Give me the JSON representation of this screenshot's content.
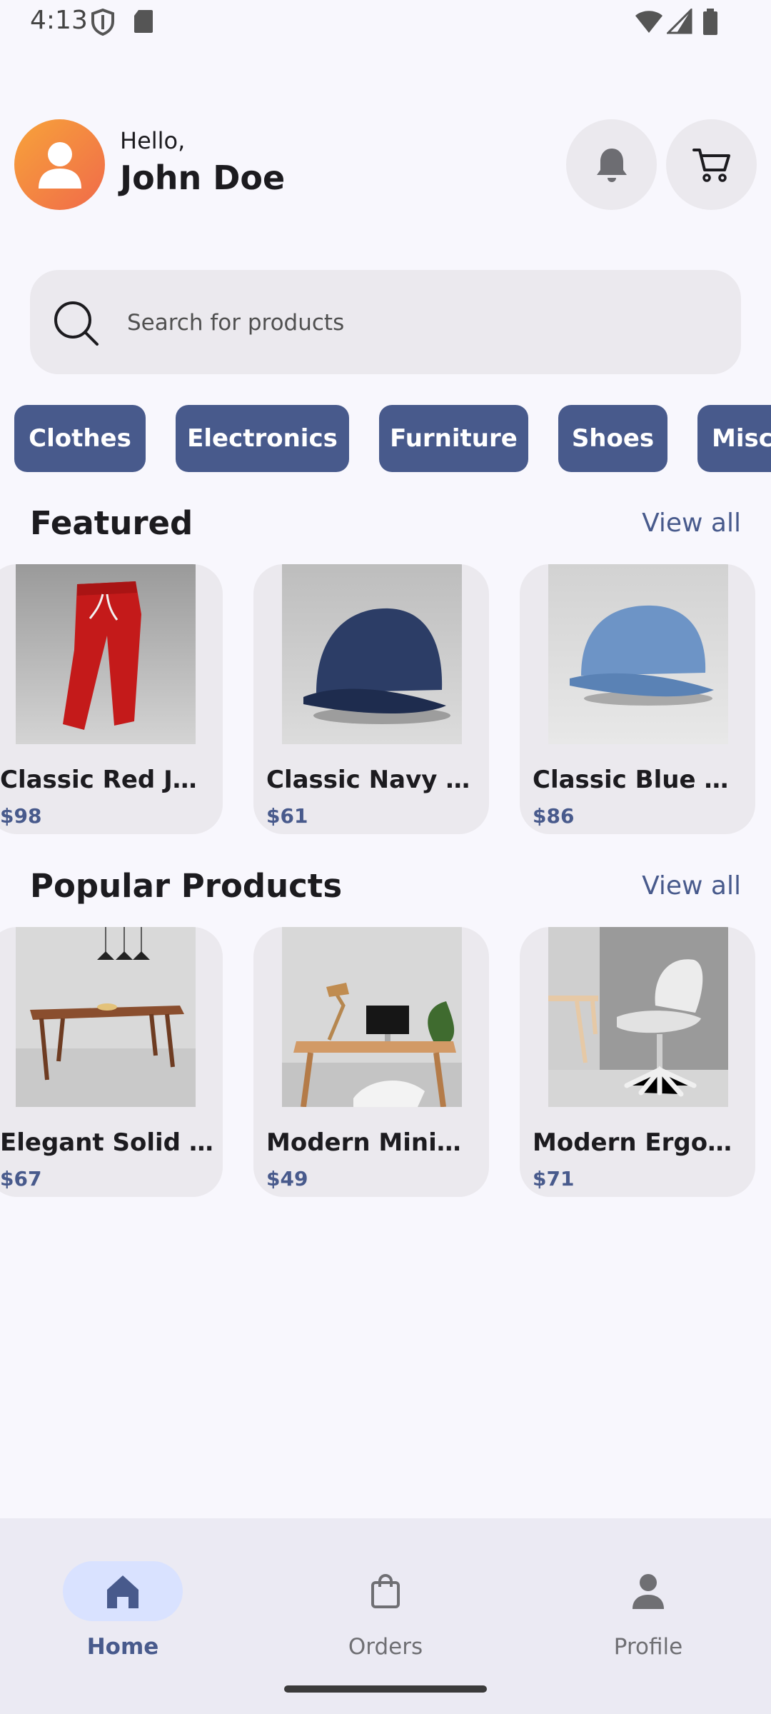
{
  "status_bar": {
    "time": "4:13"
  },
  "header": {
    "greeting": "Hello,",
    "user_name": "John Doe"
  },
  "search": {
    "placeholder": "Search for products"
  },
  "categories": [
    "Clothes",
    "Electronics",
    "Furniture",
    "Shoes",
    "Misc"
  ],
  "featured": {
    "title": "Featured",
    "view_all": "View all",
    "items": [
      {
        "name": "Classic Red J…",
        "price": "$98"
      },
      {
        "name": "Classic Navy …",
        "price": "$61"
      },
      {
        "name": "Classic Blue B…",
        "price": "$86"
      }
    ]
  },
  "popular": {
    "title": "Popular Products",
    "view_all": "View all",
    "items": [
      {
        "name": "Elegant Solid …",
        "price": "$67"
      },
      {
        "name": "Modern Minim…",
        "price": "$49"
      },
      {
        "name": "Modern Ergon…",
        "price": "$71"
      }
    ]
  },
  "bottom_nav": {
    "items": [
      {
        "label": "Home",
        "icon": "home-icon",
        "active": true
      },
      {
        "label": "Orders",
        "icon": "shopping-bag-icon",
        "active": false
      },
      {
        "label": "Profile",
        "icon": "person-icon",
        "active": false
      }
    ]
  },
  "colors": {
    "accent": "#485a8c",
    "background": "#f8f7fd",
    "surface": "#ebe9ee",
    "avatar_start": "#f7a33a",
    "avatar_end": "#f06a4a"
  }
}
